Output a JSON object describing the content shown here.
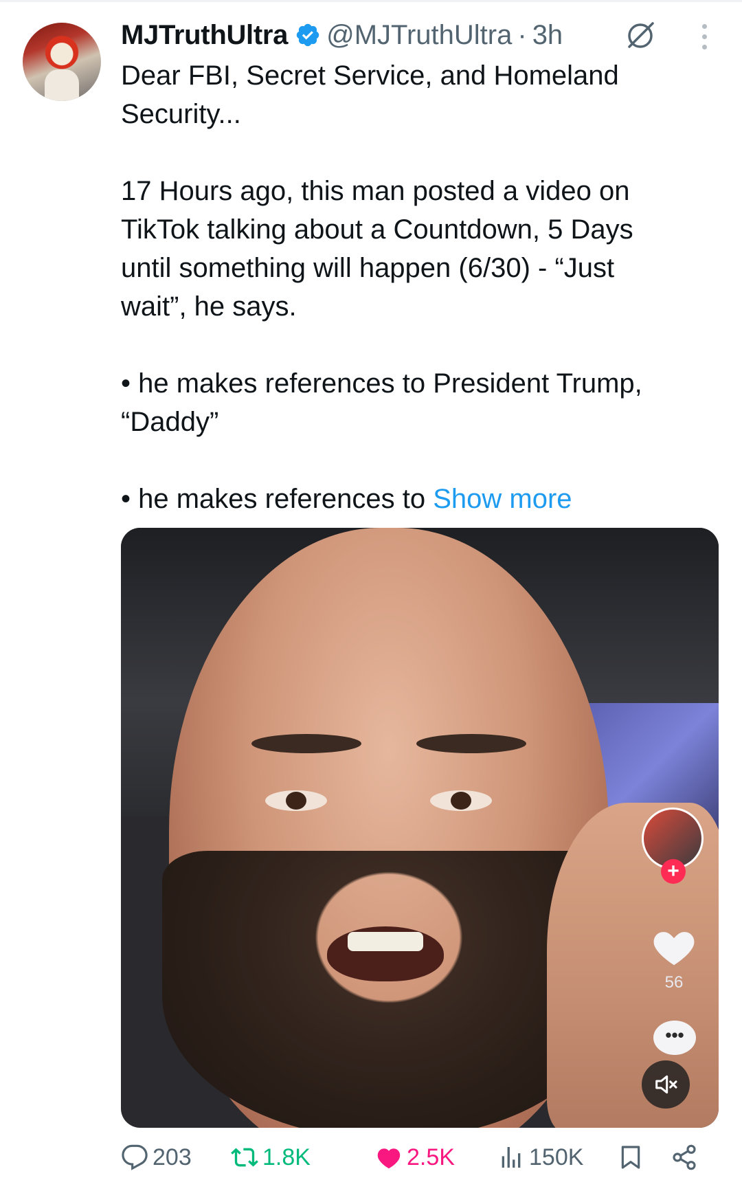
{
  "author": {
    "name": "MJTruthUltra",
    "handle": "@MJTruthUltra",
    "separator": "·",
    "time": "3h"
  },
  "post": {
    "line1": "Dear FBI, Secret Service, and Homeland",
    "line2": "Security...",
    "para2_l1": "17 Hours ago, this man posted a video on",
    "para2_l2": "TikTok talking about a Countdown, 5 Days",
    "para2_l3": "until something will happen (6/30) - “Just",
    "para2_l4": "wait”, he says.",
    "bullet1_l1": "• he makes references to President Trump,",
    "bullet1_l2": "“Daddy”",
    "bullet2_prefix": "• he makes references to ",
    "show_more": "Show more"
  },
  "media": {
    "tiktok_like_count": "56"
  },
  "actions": {
    "replies": "203",
    "reposts": "1.8K",
    "likes": "2.5K",
    "views": "150K"
  },
  "colors": {
    "link": "#1d9bf0",
    "repost": "#00ba7c",
    "like": "#f91880",
    "muted": "#536471",
    "verified": "#1d9bf0"
  },
  "icons": [
    "verified-badge-icon",
    "grok-icon",
    "more-icon",
    "reply-icon",
    "repost-icon",
    "like-icon",
    "views-icon",
    "bookmark-icon",
    "share-icon",
    "mute-icon"
  ]
}
